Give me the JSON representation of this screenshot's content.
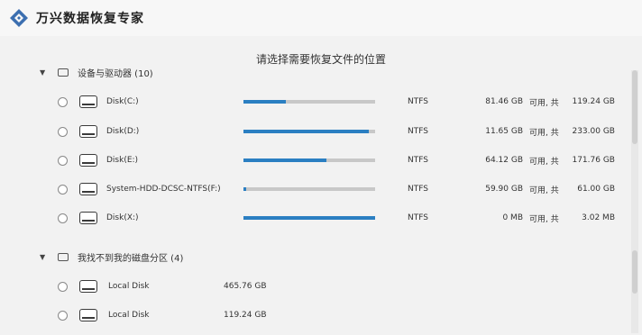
{
  "app": {
    "title": "万兴数据恢复专家"
  },
  "heading": "请选择需要恢复文件的位置",
  "groups": [
    {
      "label": "设备与驱动器 (10)",
      "drives": [
        {
          "name": "Disk(C:)",
          "fs": "NTFS",
          "available": "81.46 GB",
          "available_label": "可用, 共",
          "total": "119.24 GB",
          "used_fraction": 0.32
        },
        {
          "name": "Disk(D:)",
          "fs": "NTFS",
          "available": "11.65 GB",
          "available_label": "可用, 共",
          "total": "233.00 GB",
          "used_fraction": 0.95
        },
        {
          "name": "Disk(E:)",
          "fs": "NTFS",
          "available": "64.12 GB",
          "available_label": "可用, 共",
          "total": "171.76 GB",
          "used_fraction": 0.63
        },
        {
          "name": "System-HDD-DCSC-NTFS(F:)",
          "fs": "NTFS",
          "available": "59.90 GB",
          "available_label": "可用, 共",
          "total": "61.00 GB",
          "used_fraction": 0.02
        },
        {
          "name": "Disk(X:)",
          "fs": "NTFS",
          "available": "0 MB",
          "available_label": "可用, 共",
          "total": "3.02 MB",
          "used_fraction": 1.0
        }
      ]
    },
    {
      "label": "我找不到我的磁盘分区 (4)",
      "drives": [
        {
          "name": "Local Disk",
          "size": "465.76 GB"
        },
        {
          "name": "Local Disk",
          "size": "119.24 GB"
        }
      ]
    }
  ],
  "colors": {
    "bar_fill": "#2b7fc2",
    "bar_track": "#c8c8c8",
    "logo": "#3c6fb0"
  },
  "icons": {
    "logo": "app-logo-icon",
    "chevron": "chevron-down-icon",
    "device": "drive-icon",
    "disk": "disk-icon"
  }
}
